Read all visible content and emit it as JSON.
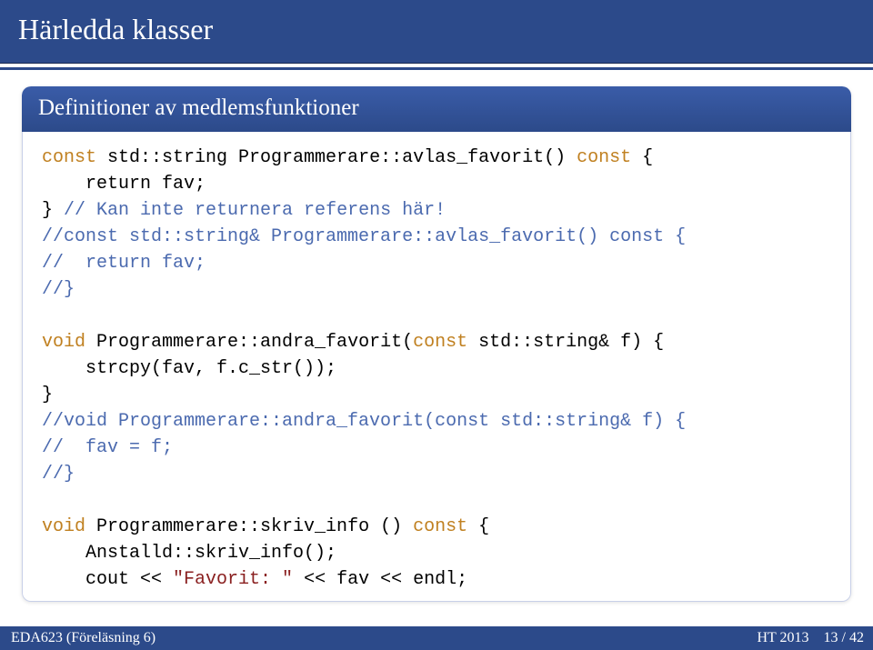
{
  "header": {
    "title": "Härledda klasser"
  },
  "block": {
    "title": "Definitioner av medlemsfunktioner"
  },
  "code": {
    "l1a": "const",
    "l1b": " std::string Programmerare::avlas_favorit() ",
    "l1c": "const",
    "l1d": " {",
    "l2": "    return fav;",
    "l3a": "} ",
    "l3b": "// Kan inte returnera referens här!",
    "l4": "//const std::string& Programmerare::avlas_favorit() const {",
    "l5": "//  return fav;",
    "l6": "//}",
    "l8a": "void",
    "l8b": " Programmerare::andra_favorit(",
    "l8c": "const",
    "l8d": " std::string& f) {",
    "l9": "    strcpy(fav, f.c_str());",
    "l10": "}",
    "l11": "//void Programmerare::andra_favorit(const std::string& f) {",
    "l12": "//  fav = f;",
    "l13": "//}",
    "l15a": "void",
    "l15b": " Programmerare::skriv_info () ",
    "l15c": "const",
    "l15d": " {",
    "l16": "    Anstalld::skriv_info();",
    "l17a": "    cout << ",
    "l17b": "\"Favorit: \"",
    "l17c": " << fav << endl;"
  },
  "footer": {
    "left": "EDA623 (Föreläsning 6)",
    "term": "HT 2013",
    "page_cur": "13",
    "page_sep": " / ",
    "page_total": "42"
  }
}
